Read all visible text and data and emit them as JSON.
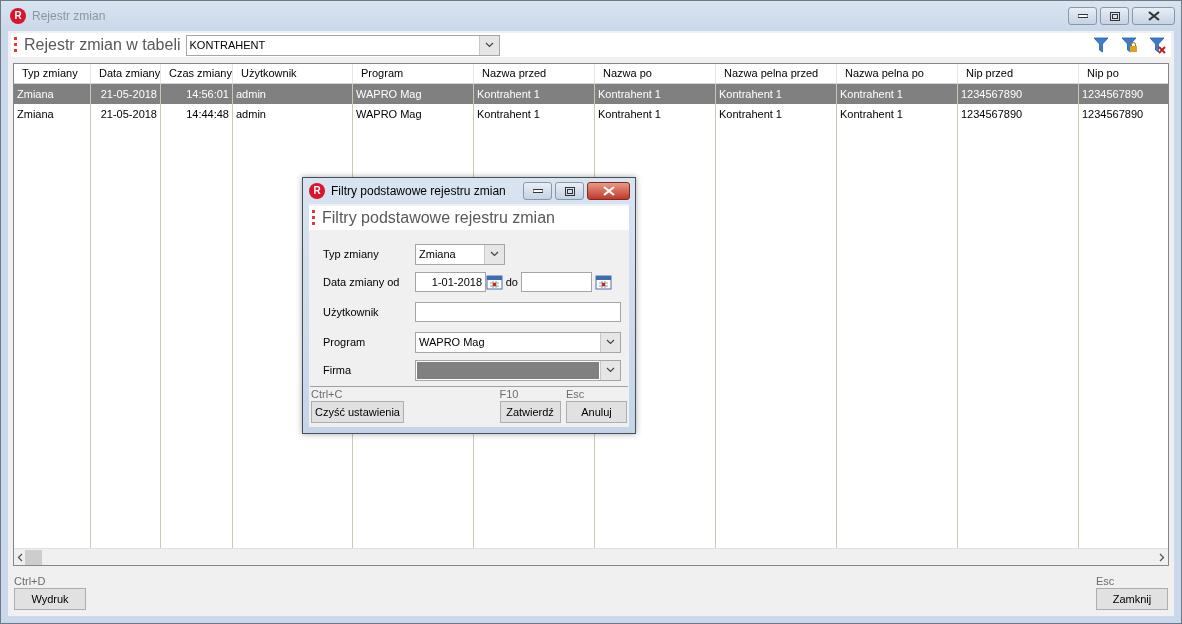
{
  "window": {
    "logo": "R",
    "title": "Rejestr zmian",
    "active": false
  },
  "header": {
    "label": "Rejestr zmian w tabeli",
    "table_select": {
      "value": "KONTRAHENT"
    }
  },
  "toolbar": [
    {
      "kind": "filter"
    },
    {
      "kind": "filter-lock"
    },
    {
      "kind": "filter-clear"
    }
  ],
  "table": {
    "columns": [
      {
        "label": "Typ zmiany",
        "kind": "text"
      },
      {
        "label": "Data zmiany",
        "kind": "date"
      },
      {
        "label": "Czas zmiany",
        "kind": "time"
      },
      {
        "label": "Użytkownik",
        "kind": "text"
      },
      {
        "label": "Program",
        "kind": "text"
      },
      {
        "label": "Nazwa przed",
        "kind": "text"
      },
      {
        "label": "Nazwa po",
        "kind": "text"
      },
      {
        "label": "Nazwa pelna przed",
        "kind": "text"
      },
      {
        "label": "Nazwa pelna po",
        "kind": "text"
      },
      {
        "label": "Nip przed",
        "kind": "text"
      },
      {
        "label": "Nip po",
        "kind": "text"
      }
    ],
    "rows": [
      {
        "selected": true,
        "cells": [
          "Zmiana",
          "21-05-2018",
          "14:56:01",
          "admin",
          "WAPRO Mag",
          "Kontrahent 1",
          "Kontrahent 1",
          "Kontrahent 1",
          "Kontrahent 1",
          "1234567890",
          "1234567890"
        ]
      },
      {
        "selected": false,
        "cells": [
          "Zmiana",
          "21-05-2018",
          "14:44:48",
          "admin",
          "WAPRO Mag",
          "Kontrahent 1",
          "Kontrahent 1",
          "Kontrahent 1",
          "Kontrahent 1",
          "1234567890",
          "1234567890"
        ]
      }
    ]
  },
  "footer": {
    "left": {
      "shortcut": "Ctrl+D",
      "label": "Wydruk"
    },
    "right": {
      "shortcut": "Esc",
      "label": "Zamknij"
    }
  },
  "dialog": {
    "logo": "R",
    "title": "Filtry podstawowe rejestru zmian",
    "active": true,
    "heading": "Filtry podstawowe rejestru zmian",
    "fields": [
      {
        "kind": "short-select",
        "label": "Typ zmiany",
        "value": "Zmiana"
      },
      {
        "kind": "date-range",
        "label": "Data zmiany od",
        "from": "1-01-2018",
        "separator": "do"
      },
      {
        "kind": "text",
        "label": "Użytkownik"
      },
      {
        "kind": "select",
        "label": "Program",
        "value": "WAPRO Mag"
      },
      {
        "kind": "select",
        "label": "Firma",
        "disabled": true
      }
    ],
    "buttons": [
      {
        "shortcut": "Ctrl+C",
        "label": "Czyść ustawienia"
      },
      {
        "shortcut": "F10",
        "label": "Zatwierdź"
      },
      {
        "shortcut": "Esc",
        "label": "Anuluj"
      }
    ]
  }
}
